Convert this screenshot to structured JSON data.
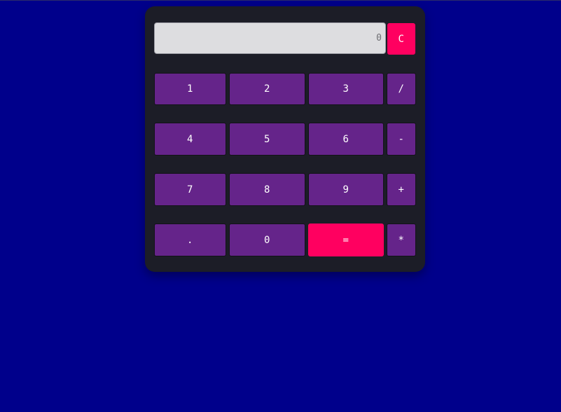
{
  "calculator": {
    "display": {
      "value": "0"
    },
    "clear_label": "C",
    "keys": {
      "k1": "1",
      "k2": "2",
      "k3": "3",
      "divide": "/",
      "k4": "4",
      "k5": "5",
      "k6": "6",
      "minus": "-",
      "k7": "7",
      "k8": "8",
      "k9": "9",
      "plus": "+",
      "dot": ".",
      "k0": "0",
      "equals": "=",
      "multiply": "*"
    }
  },
  "colors": {
    "page_background": "#00008b",
    "panel": "#1c1d27",
    "key": "#65248a",
    "accent": "#ff0060",
    "display": "#dddde0"
  }
}
